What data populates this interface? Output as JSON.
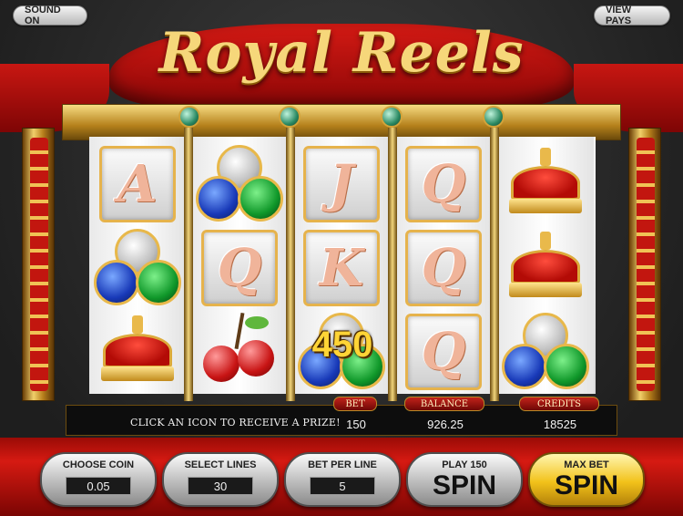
{
  "top_controls": {
    "sound_label": "SOUND ON",
    "view_pays_label": "VIEW PAYS"
  },
  "game": {
    "title": "Royal Reels",
    "win_amount": "450"
  },
  "reels": [
    [
      "A",
      "gems",
      "crown"
    ],
    [
      "gems",
      "Q",
      "cherry"
    ],
    [
      "J",
      "K",
      "gems"
    ],
    [
      "Q",
      "Q",
      "Q"
    ],
    [
      "crown",
      "crown",
      "gems"
    ]
  ],
  "info_bar": {
    "message": "CLICK AN ICON TO RECEIVE A PRIZE!",
    "bet_label": "BET",
    "bet_value": "150",
    "balance_label": "BALANCE",
    "balance_value": "926.25",
    "credits_label": "CREDITS",
    "credits_value": "18525"
  },
  "controls": {
    "coin_label": "CHOOSE COIN",
    "coin_value": "0.05",
    "lines_label": "SELECT LINES",
    "lines_value": "30",
    "bet_per_line_label": "BET PER LINE",
    "bet_per_line_value": "5",
    "spin_top": "PLAY 150",
    "spin_label": "SPIN",
    "max_top": "MAX BET",
    "max_label": "SPIN"
  },
  "colors": {
    "accent_gold": "#f6d77a",
    "drape_red": "#d41a14",
    "win_yellow": "#ffd436"
  }
}
